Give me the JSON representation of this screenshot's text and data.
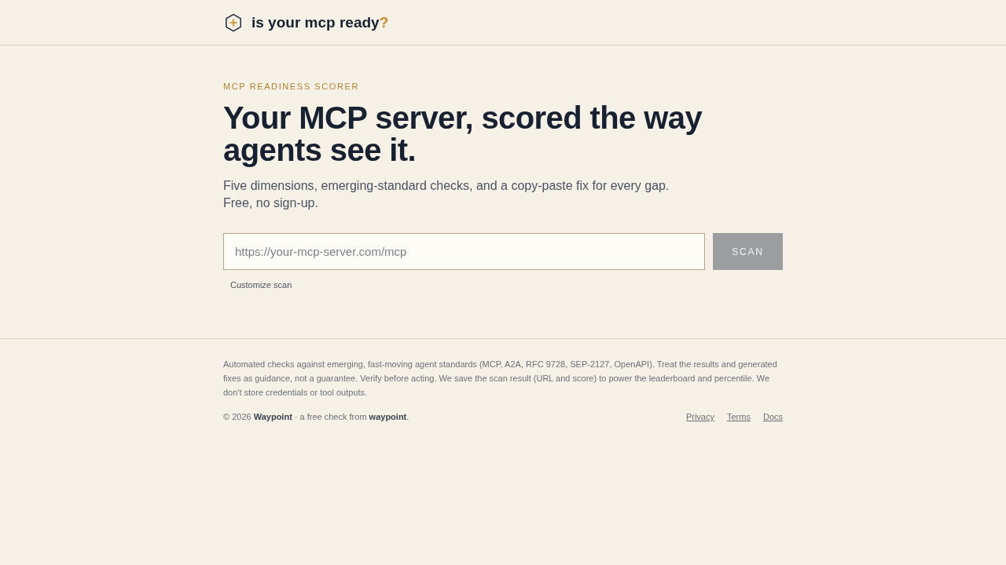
{
  "header": {
    "title": "is your mcp ready",
    "title_accent": "?"
  },
  "hero": {
    "eyebrow": "MCP READINESS SCORER",
    "headline": "Your MCP server, scored the way agents see it.",
    "subtitle_lines": [
      "Five dimensions, emerging-standard checks, and a copy-paste fix for every gap.",
      "Free, no sign-up."
    ]
  },
  "scan_form": {
    "placeholder": "https://your-mcp-server.com/mcp",
    "button": "SCAN",
    "button_disabled": true,
    "customize_link": "Customize scan"
  },
  "footer": {
    "disclaimer": "Automated checks against emerging, fast-moving agent standards (MCP, A2A, RFC 9728, SEP-2127, OpenAPI). Treat the results and generated fixes as guidance, not a guarantee. Verify before acting. We save the scan result (URL and score) to power the leaderboard and percentile. We don't store credentials or tool outputs.",
    "copyright": "© 2026 **Waypoint** · a free check from **waypoint**.",
    "links": [
      "Privacy",
      "Terms",
      "Docs"
    ]
  }
}
